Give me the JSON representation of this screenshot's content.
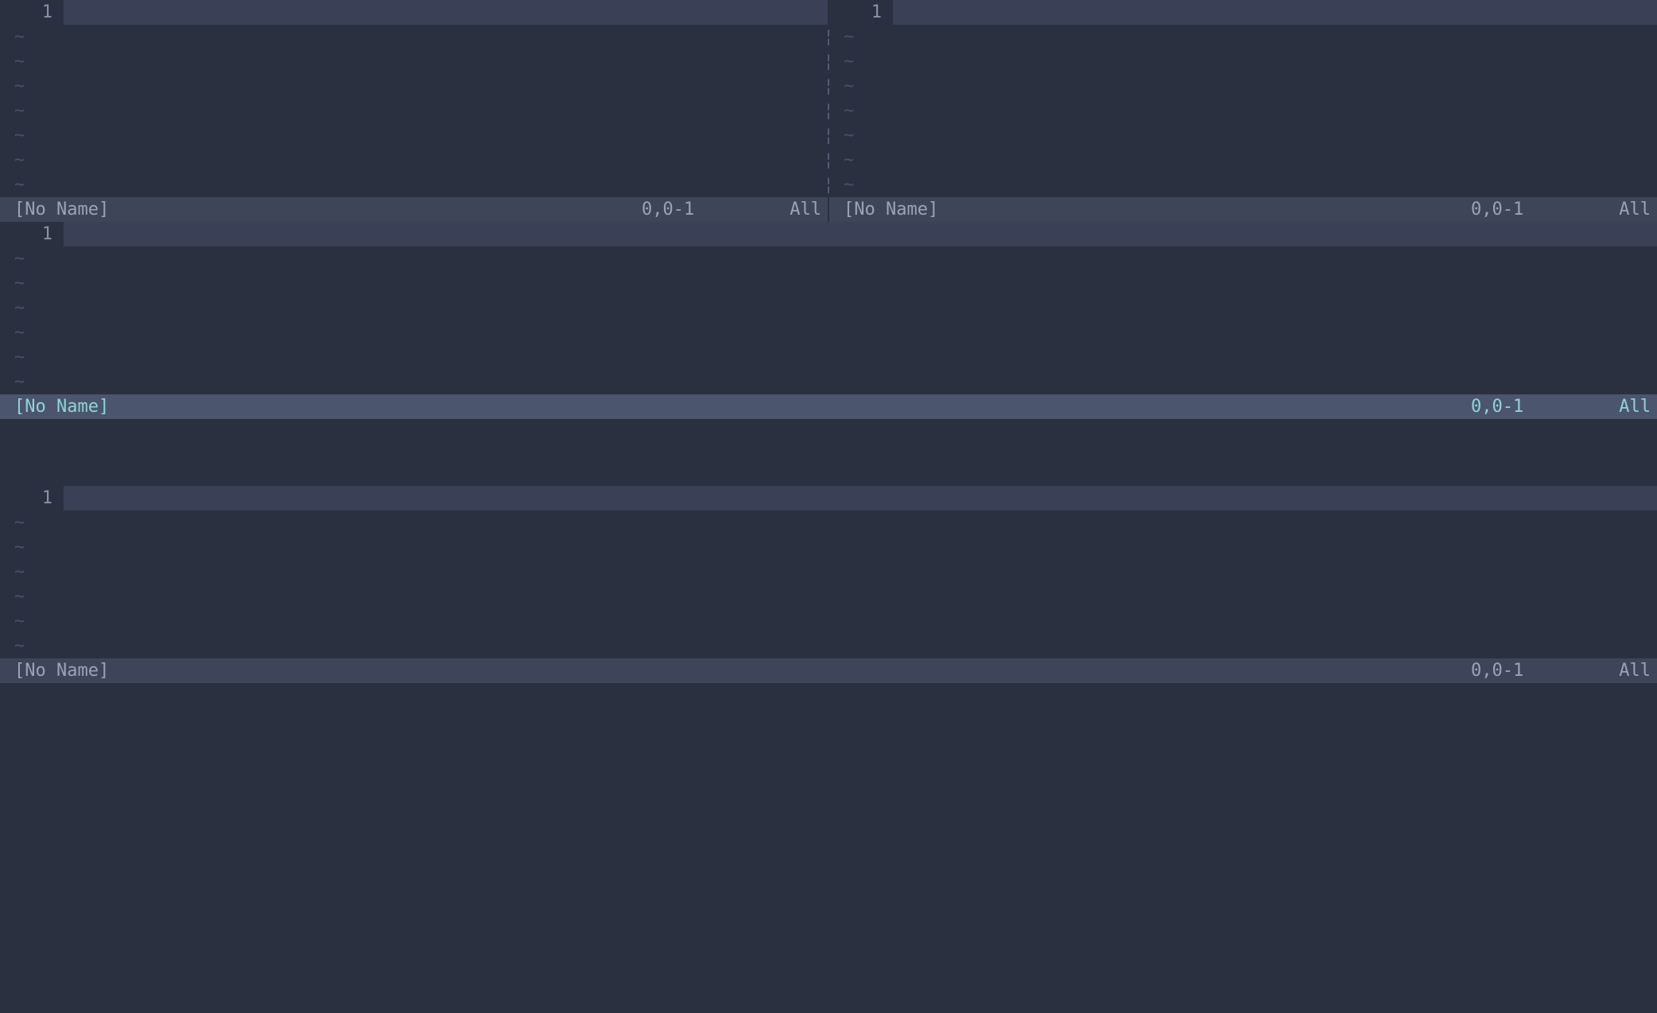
{
  "panes": {
    "topLeft": {
      "lineNumber": "1",
      "tildeCount": 7,
      "status": {
        "name": "[No Name]",
        "pos": "0,0-1",
        "pct": "All",
        "active": false
      }
    },
    "topRight": {
      "lineNumber": "1",
      "tildeCount": 7,
      "status": {
        "name": "[No Name]",
        "pos": "0,0-1",
        "pct": "All",
        "active": false
      }
    },
    "middle": {
      "lineNumber": "1",
      "tildeCount": 6,
      "status": {
        "name": "[No Name]",
        "pos": "0,0-1",
        "pct": "All",
        "active": true
      }
    },
    "bottom": {
      "lineNumber": "1",
      "tildeCount": 6,
      "status": {
        "name": "[No Name]",
        "pos": "0,0-1",
        "pct": "All",
        "active": false
      }
    }
  },
  "tildeGlyph": "~",
  "sepGlyph": "¦"
}
